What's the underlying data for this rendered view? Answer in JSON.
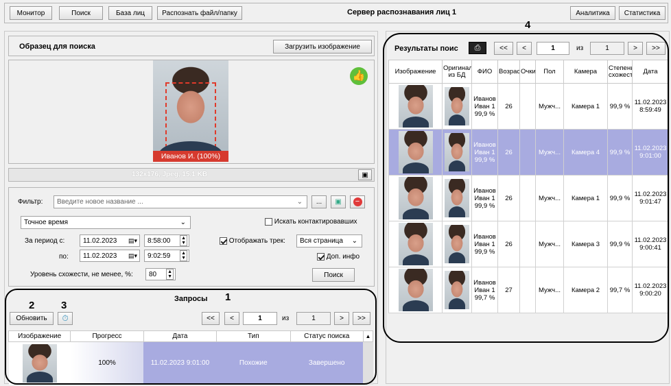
{
  "toolbar": {
    "monitor": "Монитор",
    "search": "Поиск",
    "facebase": "База лиц",
    "recognize": "Распознать файл/папку",
    "title": "Сервер распознавания лиц 1",
    "analytics": "Аналитика",
    "statistics": "Статистика"
  },
  "sample": {
    "title": "Образец для поиска",
    "load_button": "Загрузить изображение",
    "face_label": "Иванов И. (100%)",
    "image_info": "132x176, Jpeg, 15,1 KB"
  },
  "filter": {
    "label": "Фильтр:",
    "placeholder": "Введите новое название ...",
    "time_mode": "Точное время",
    "search_contacted": "Искать контактировавших",
    "period_from_label": "За период с:",
    "period_to_label": "по:",
    "date_from": "11.02.2023",
    "time_from": "8:58:00",
    "date_to": "11.02.2023",
    "time_to": "9:02:59",
    "show_track": "Отображать трек:",
    "track_value": "Вся страница",
    "extra_info": "Доп. инфо",
    "similarity_label": "Уровень схожести, не менее, %:",
    "similarity_value": "80",
    "search_button": "Поиск"
  },
  "requests": {
    "title": "Запросы",
    "refresh": "Обновить",
    "page": "1",
    "of": "из",
    "total": "1",
    "headers": [
      "Изображение",
      "Прогресс",
      "Дата",
      "Тип",
      "Статус поиска"
    ],
    "rows": [
      {
        "progress": "100%",
        "date": "11.02.2023 9:01:00",
        "type": "Похожие",
        "status": "Завершено"
      }
    ]
  },
  "results": {
    "title": "Результаты поис",
    "page": "1",
    "of": "из",
    "total": "1",
    "headers": [
      "Изображение",
      "Оригинал из БД",
      "ФИО",
      "Возраст",
      "Очки",
      "Пол",
      "Камера",
      "Степень схожести",
      "Дата"
    ],
    "rows": [
      {
        "name": "Иванов Иван 1 99,9 %",
        "age": "26",
        "sex": "Мужч...",
        "camera": "Камера 1",
        "sim": "99,9 %",
        "date": "11.02.2023 8:59:49"
      },
      {
        "name": "Иванов Иван 1 99,9 %",
        "age": "26",
        "sex": "Мужч...",
        "camera": "Камера 4",
        "sim": "99,9 %",
        "date": "11.02.2023 9:01:00"
      },
      {
        "name": "Иванов Иван 1 99,9 %",
        "age": "26",
        "sex": "Мужч...",
        "camera": "Камера 1",
        "sim": "99,9 %",
        "date": "11.02.2023 9:01:47"
      },
      {
        "name": "Иванов Иван 1 99,9 %",
        "age": "26",
        "sex": "Мужч...",
        "camera": "Камера 3",
        "sim": "99,9 %",
        "date": "11.02.2023 9:00:41"
      },
      {
        "name": "Иванов Иван 1 99,7 %",
        "age": "27",
        "sex": "Мужч...",
        "camera": "Камера 2",
        "sim": "99,7 %",
        "date": "11.02.2023 9:00:20"
      }
    ]
  },
  "callouts": {
    "c1": "1",
    "c2": "2",
    "c3": "3",
    "c4": "4"
  },
  "colors": {
    "selected_row": "#a8abe0",
    "green_badge": "#5fbf3a",
    "face_frame": "#e03a2a"
  }
}
